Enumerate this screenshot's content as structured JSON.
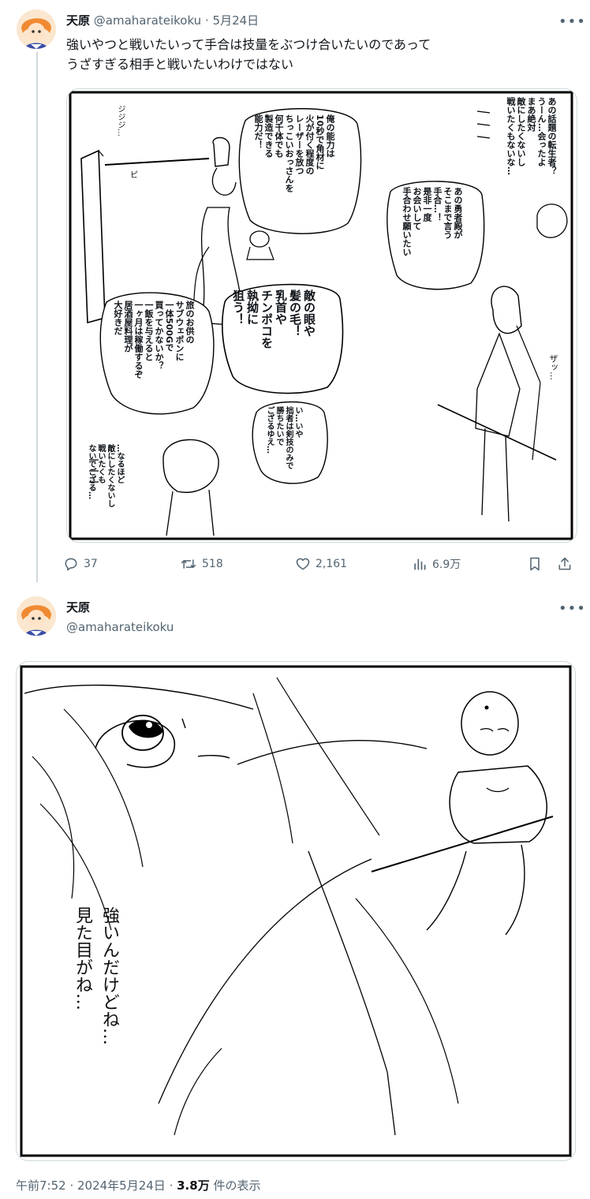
{
  "tweet1": {
    "display_name": "天原",
    "handle": "@amaharateikoku",
    "separator": "·",
    "date": "5月24日",
    "text": "強いやつと戦いたいって手合は技量をぶつけ合いたいのであって\nうざすぎる相手と戦いたいわけではない",
    "comic_texts": {
      "panel1_sfx": "ジジジ…",
      "panel1_sfx2": "ピ",
      "bubble_ability": "俺の能力は\n10秒で角材に\n火が付く程度の\nレーザーを放つ\nちっこいおっさんを\n何千体でも\n製造できる\n能力だ！",
      "bubble_reincarnated": "あの話題の転生者？\nうーん…会ったよ\nまあ絶対\n敵にしたくないし\n戦いたくもないな…",
      "bubble_hero": "あの勇者殿が\nそこまで言う\n手合…！\n是非一度\nお会いして\n手合わせ願いたい",
      "bubble_target": "敵の眼や\n髪の毛！\n乳首や\nチンポコを\n執拗に\n狙う！",
      "bubble_travel": "旅のお供の\nサブウェポンに\n一体500Gで\n買ってかないか？\n一飯を与えると\n一ヶ月は稼働するぞ\n居酒屋料理が\n大好きだ",
      "bubble_sword": "い…いや\n拙者は剣技のみで\n勝ちたいで\nござるゆえ…",
      "bubble_naruhodo": "…なるほど\n敵にしたくないし\n戦いたくも\nないでござる…",
      "sfx_zawa": "ザッ…"
    },
    "stats": {
      "replies": "37",
      "retweets": "518",
      "likes": "2,161",
      "views": "6.9万"
    }
  },
  "tweet2": {
    "display_name": "天原",
    "handle": "@amaharateikoku",
    "comic_texts": {
      "handwritten": "強いんだけどね…\n見た目がね…"
    }
  },
  "footer": {
    "time": "午前7:52",
    "separator": " · ",
    "date": "2024年5月24日",
    "views_count": "3.8万",
    "views_label": " 件の表示"
  },
  "colors": {
    "text_primary": "#0f1419",
    "text_secondary": "#536471",
    "border": "#cfd9de"
  },
  "icons": [
    "reply-icon",
    "retweet-icon",
    "like-icon",
    "views-icon",
    "bookmark-icon",
    "share-icon",
    "more-icon"
  ]
}
